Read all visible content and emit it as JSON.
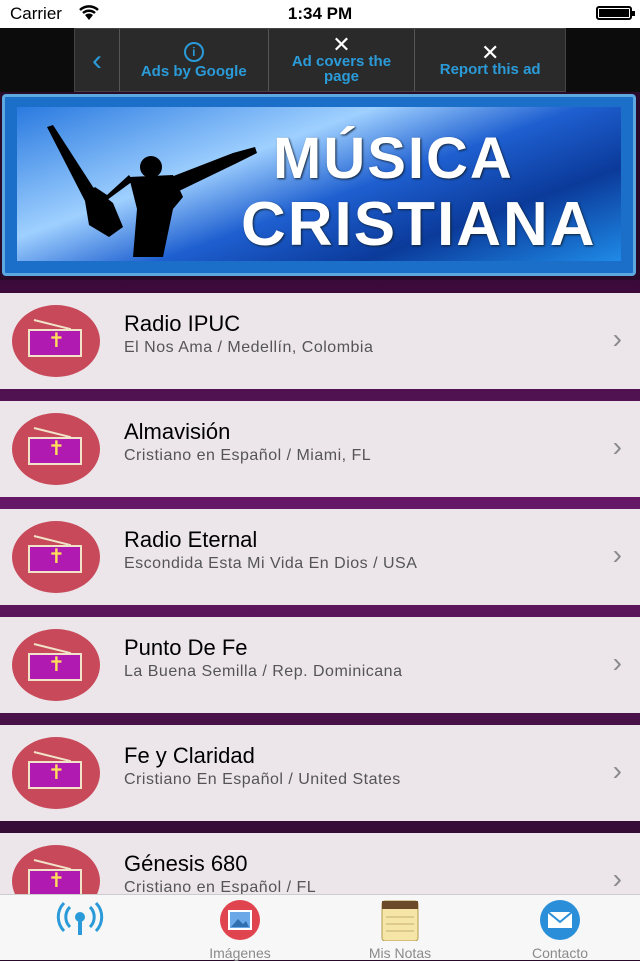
{
  "status_bar": {
    "carrier": "Carrier",
    "time": "1:34 PM"
  },
  "ad": {
    "back_icon": "chevron-left-icon",
    "ads_by_google": "Ads by Google",
    "ad_covers_page": "Ad covers the page",
    "report_ad": "Report this ad"
  },
  "banner": {
    "line1": "MÚSICA",
    "line2": "CRISTIANA"
  },
  "stations": [
    {
      "name": "Radio IPUC",
      "subtitle": "El Nos Ama / Medellín, Colombia"
    },
    {
      "name": "Almavisión",
      "subtitle": "Cristiano en Español / Miami, FL"
    },
    {
      "name": "Radio Eternal",
      "subtitle": "Escondida Esta Mi Vida En Dios / USA"
    },
    {
      "name": "Punto De Fe",
      "subtitle": "La Buena Semilla / Rep. Dominicana"
    },
    {
      "name": "Fe y Claridad",
      "subtitle": "Cristiano En Español / United States"
    },
    {
      "name": "Génesis 680",
      "subtitle": "Cristiano en Español / FL"
    }
  ],
  "tabs": [
    {
      "label": "",
      "icon": "radio-broadcast-icon"
    },
    {
      "label": "Imágenes",
      "icon": "photos-icon"
    },
    {
      "label": "Mis Notas",
      "icon": "notepad-icon"
    },
    {
      "label": "Contacto",
      "icon": "mail-icon"
    }
  ],
  "colors": {
    "accent": "#2a9bd8",
    "row_bg": "#ece6ea",
    "icon_circle": "#c84a5a",
    "radio_body": "#b01ab0"
  }
}
